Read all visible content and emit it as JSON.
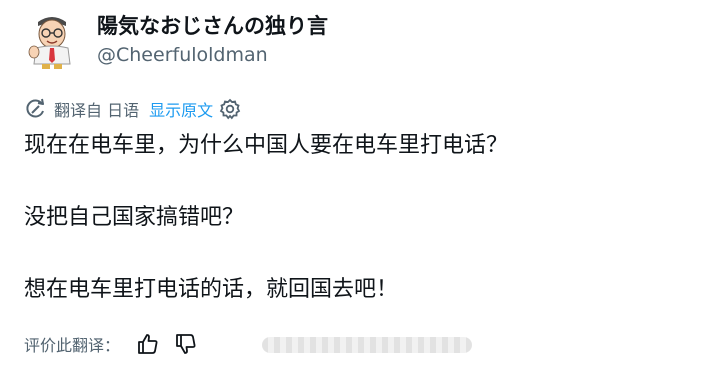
{
  "user": {
    "display_name": "陽気なおじさんの独り言",
    "handle": "@Cheerfuloldman"
  },
  "translation": {
    "translated_from_label": "翻译自 日语",
    "show_original_label": "显示原文"
  },
  "tweet": {
    "paragraphs": [
      "现在在电车里，为什么中国人要在电车里打电话？",
      "没把自己国家搞错吧？",
      "想在电车里打电话的话，就回国去吧！"
    ]
  },
  "rating": {
    "prompt_label": "评价此翻译："
  },
  "icons": {
    "avatar": "cartoon-old-man-avatar",
    "translate": "translate-icon",
    "settings": "gear-icon",
    "like": "thumbs-up-icon",
    "dislike": "thumbs-down-icon"
  }
}
